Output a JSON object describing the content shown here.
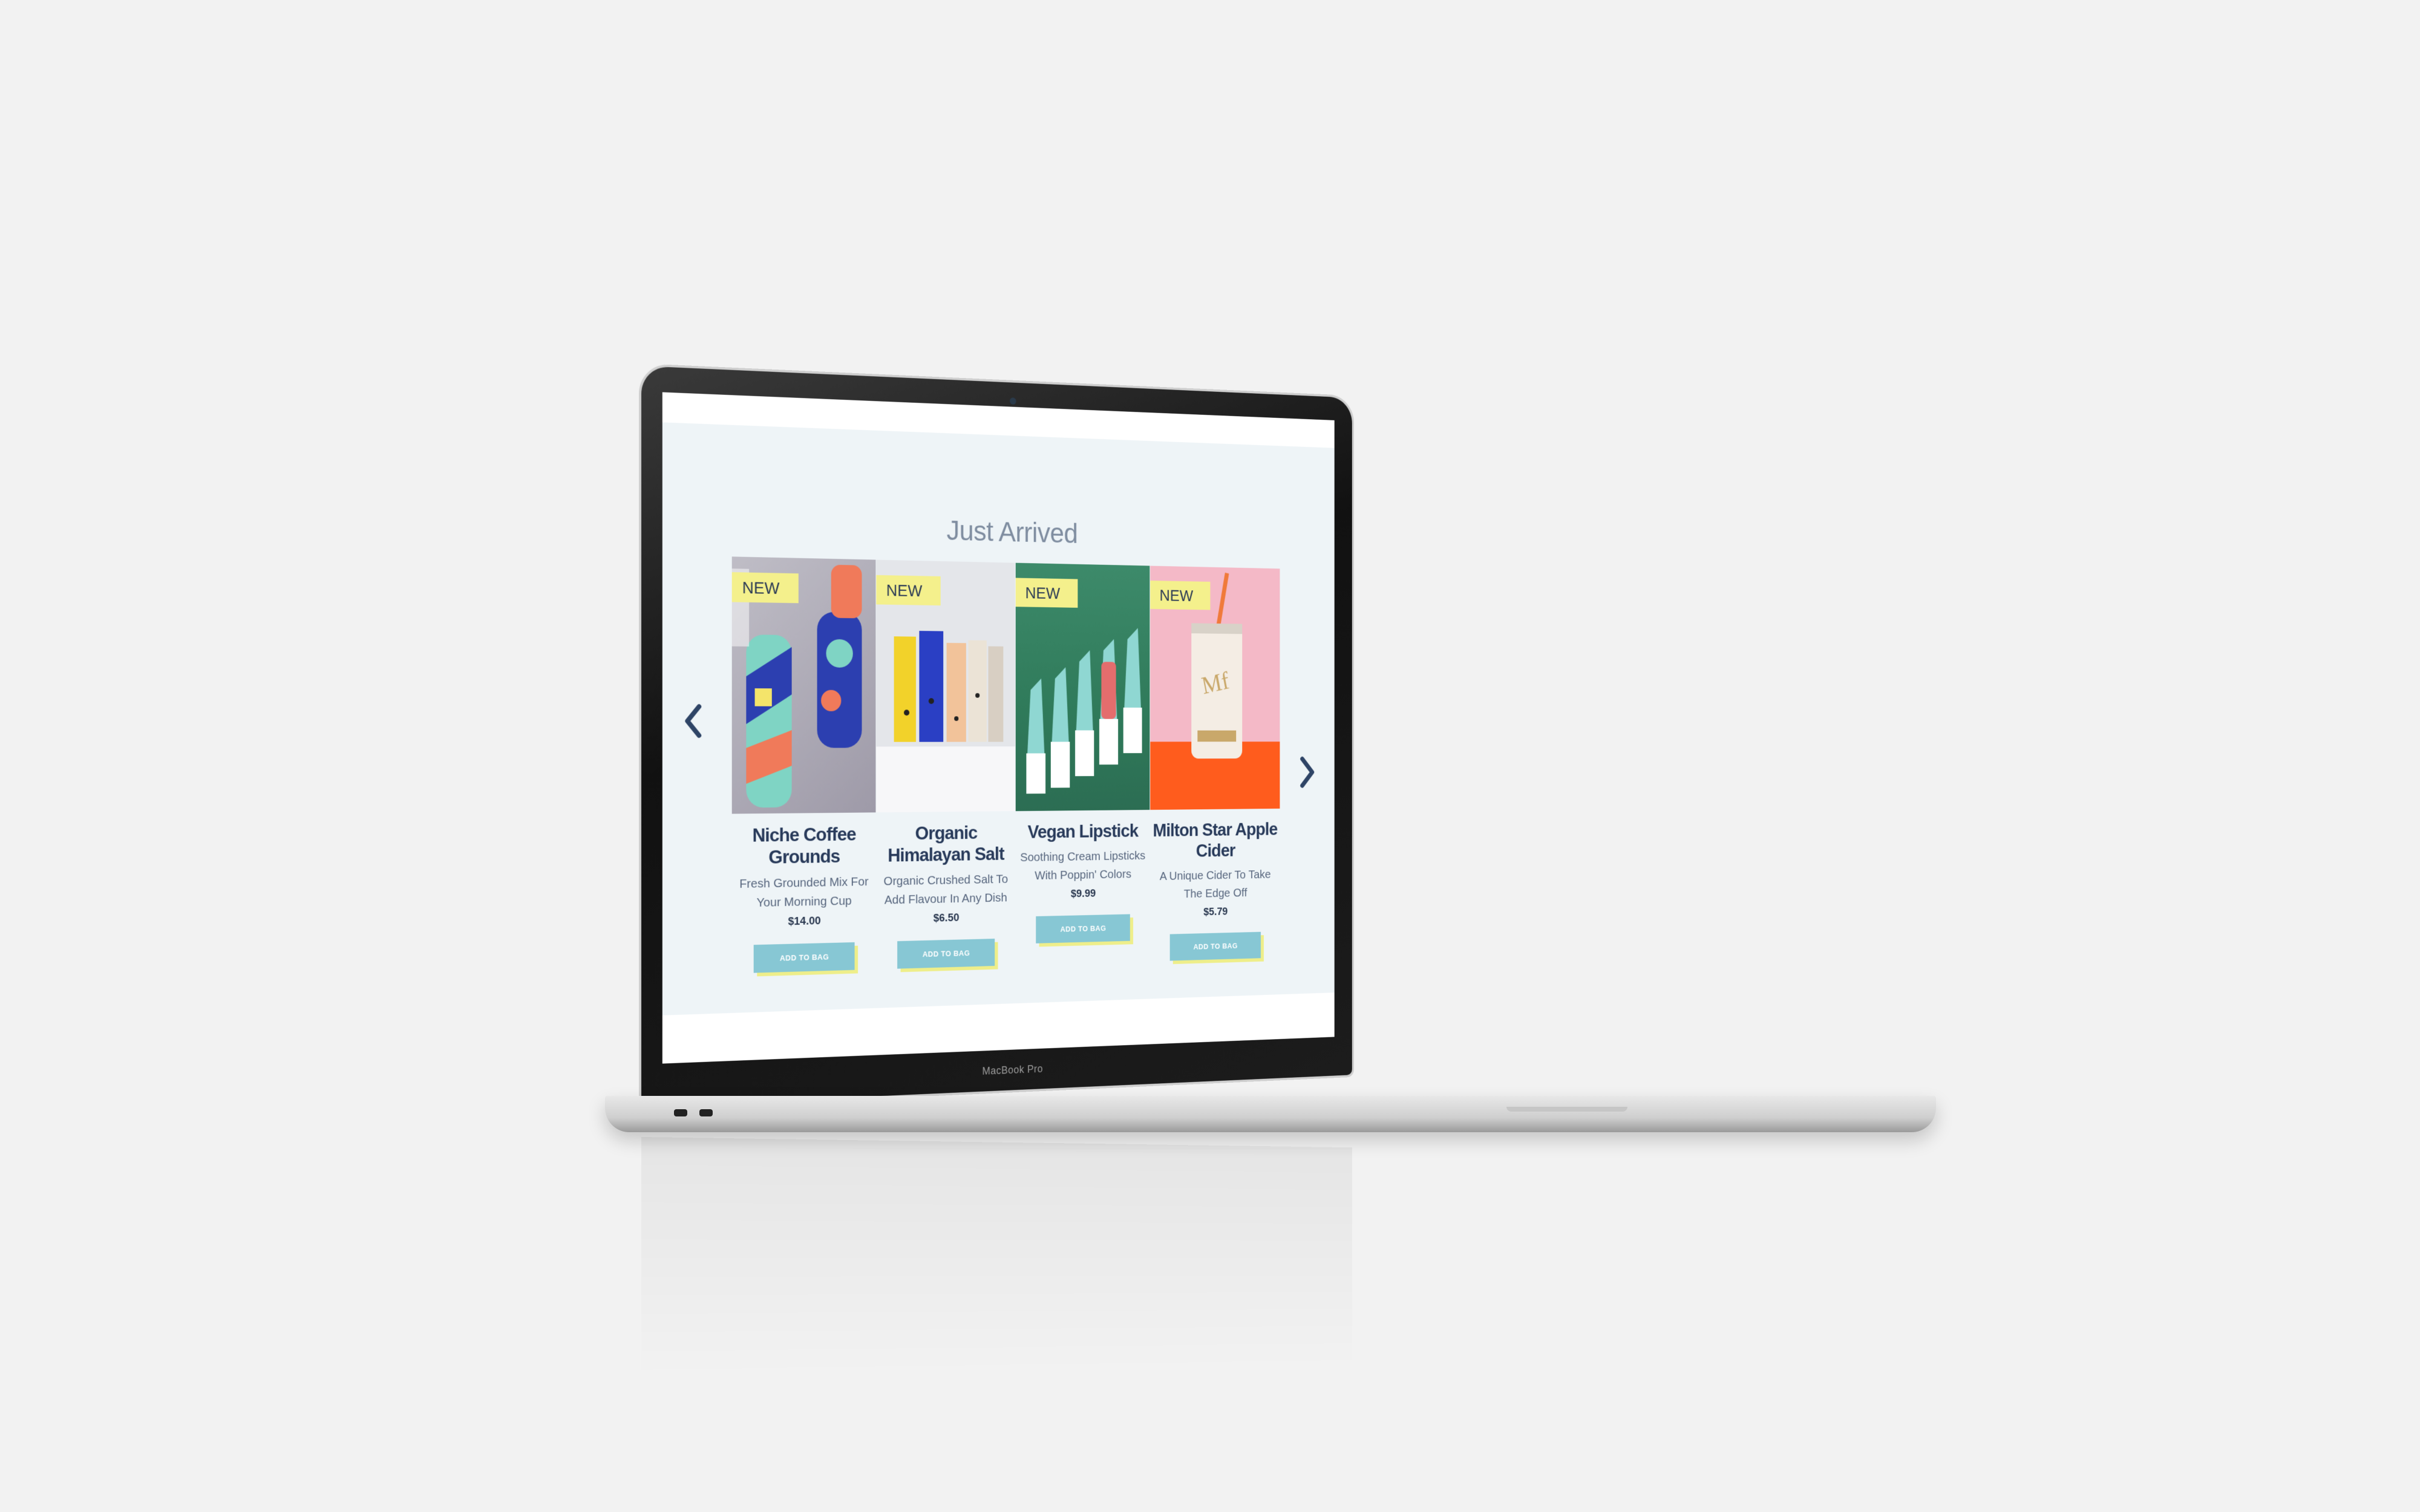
{
  "device": {
    "brand_label": "MacBook Pro"
  },
  "section": {
    "title": "Just Arrived"
  },
  "carousel": {
    "prev_icon": "chevron-left-icon",
    "next_icon": "chevron-right-icon"
  },
  "products": [
    {
      "badge": "NEW",
      "name": "Niche Coffee Grounds",
      "description": "Fresh Grounded Mix For Your Morning Cup",
      "price": "$14.00",
      "button": "ADD TO BAG"
    },
    {
      "badge": "NEW",
      "name": "Organic Himalayan Salt",
      "description": "Organic Crushed Salt To Add Flavour In Any Dish",
      "price": "$6.50",
      "button": "ADD TO BAG"
    },
    {
      "badge": "NEW",
      "name": "Vegan Lipstick",
      "description": "Soothing Cream Lipsticks With Poppin' Colors",
      "price": "$9.99",
      "button": "ADD TO BAG"
    },
    {
      "badge": "NEW",
      "name": "Milton Star Apple Cider",
      "description": "A Unique Cider To Take The Edge Off",
      "price": "$5.79",
      "button": "ADD TO BAG"
    }
  ],
  "colors": {
    "badge": "#f4f08c",
    "button": "#87c7d4",
    "button_shadow": "#eeee8a",
    "title": "#7f8da0",
    "section_bg": "#eef4f7"
  }
}
